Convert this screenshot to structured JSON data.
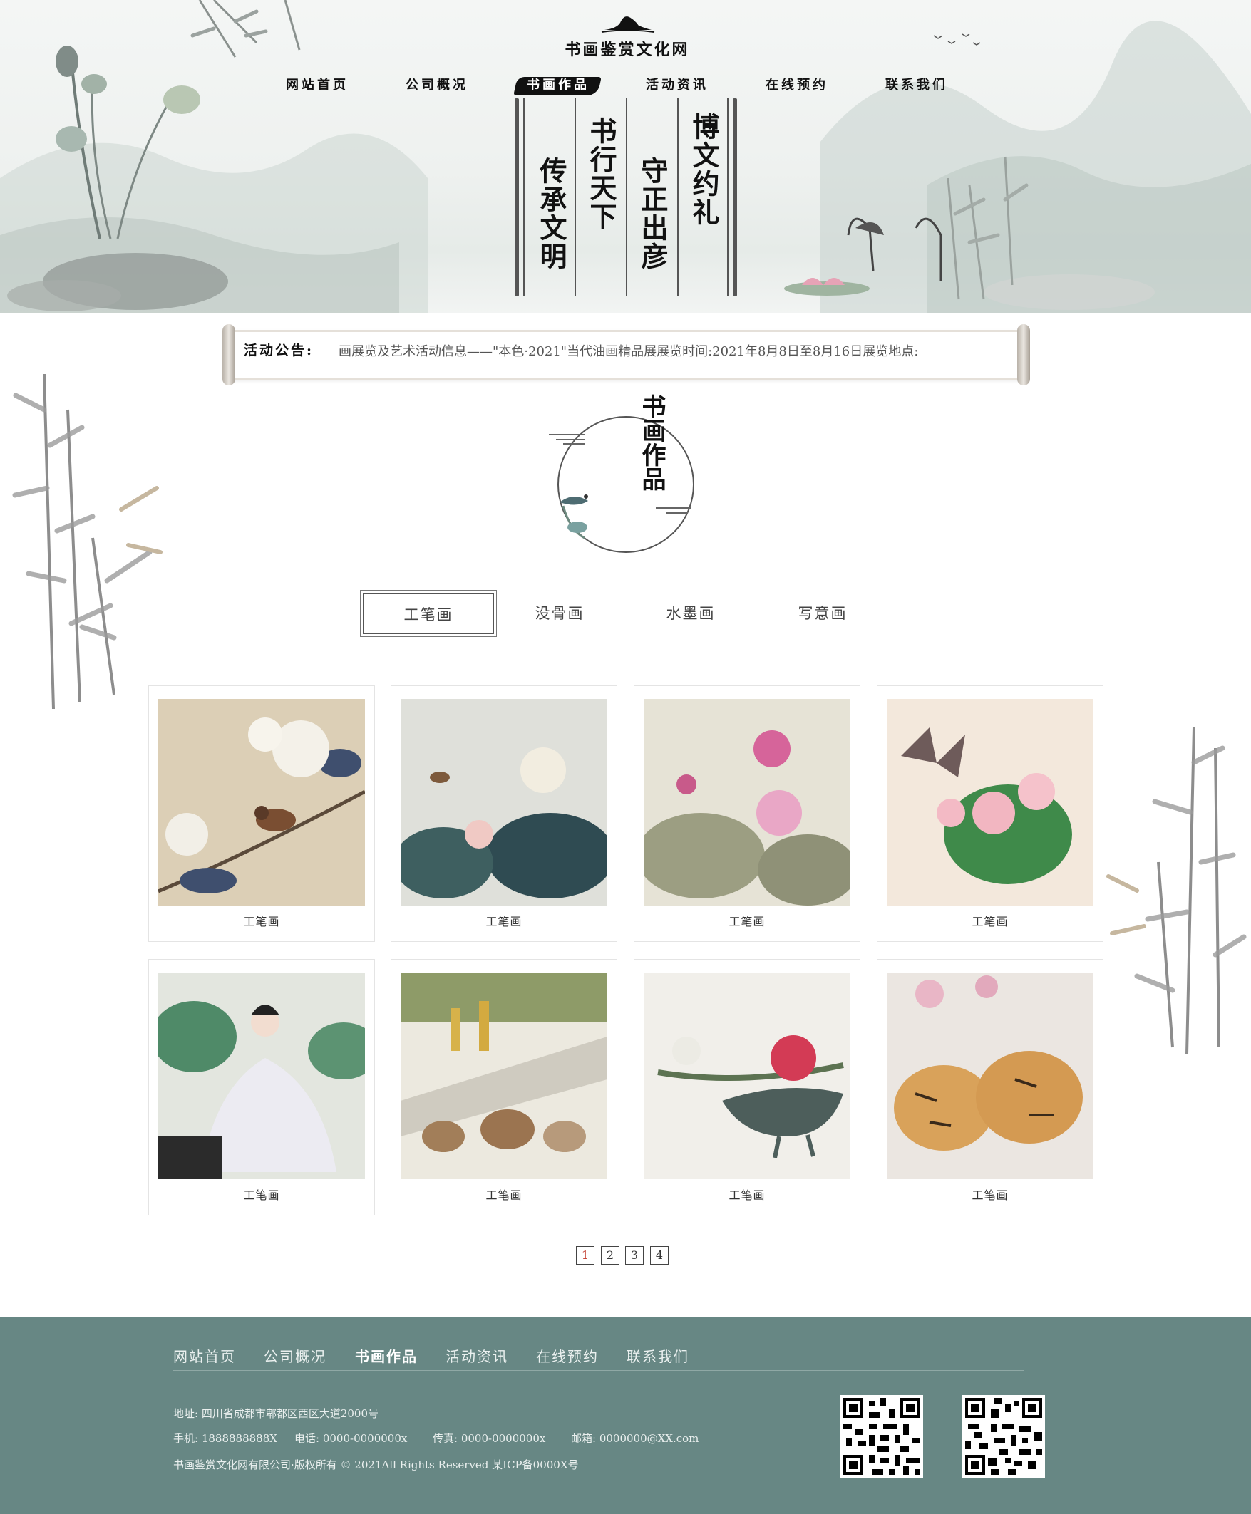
{
  "site": {
    "logo_text": "书画鉴赏文化网"
  },
  "nav": {
    "items": [
      {
        "label": "网站首页"
      },
      {
        "label": "公司概况"
      },
      {
        "label": "书画作品"
      },
      {
        "label": "活动资讯"
      },
      {
        "label": "在线预约"
      },
      {
        "label": "联系我们"
      }
    ],
    "active_index": 2
  },
  "hero_scroll": {
    "columns": [
      "博文约礼",
      "守正出彦",
      "书行天下",
      "传承文明"
    ]
  },
  "notice": {
    "label": "活动公告:",
    "text": "画展览及艺术活动信息——\"本色·2021\"当代油画精品展展览时间:2021年8月8日至8月16日展览地点:"
  },
  "section": {
    "title": "书画作品"
  },
  "tabs": [
    {
      "label": "工笔画",
      "active": true
    },
    {
      "label": "没骨画",
      "active": false
    },
    {
      "label": "水墨画",
      "active": false
    },
    {
      "label": "写意画",
      "active": false
    }
  ],
  "gallery": [
    {
      "caption": "工笔画",
      "subject": "bird-hydrangea"
    },
    {
      "caption": "工笔画",
      "subject": "lotus-leaves-bird"
    },
    {
      "caption": "工笔画",
      "subject": "pink-lotus"
    },
    {
      "caption": "工笔画",
      "subject": "butterfly-peony"
    },
    {
      "caption": "工笔画",
      "subject": "lady-lotus"
    },
    {
      "caption": "工笔画",
      "subject": "rabbits-corn"
    },
    {
      "caption": "工笔画",
      "subject": "peony-vase"
    },
    {
      "caption": "工笔画",
      "subject": "tigers"
    }
  ],
  "pagination": {
    "pages": [
      "1",
      "2",
      "3",
      "4"
    ],
    "current": "1"
  },
  "footer": {
    "nav": [
      {
        "label": "网站首页"
      },
      {
        "label": "公司概况"
      },
      {
        "label": "书画作品"
      },
      {
        "label": "活动资讯"
      },
      {
        "label": "在线预约"
      },
      {
        "label": "联系我们"
      }
    ],
    "address": "地址: 四川省成都市郫都区西区大道2000号",
    "phone": "手机: 1888888888X",
    "tel": "电话: 0000-0000000x",
    "fax": "传真: 0000-0000000x",
    "email": "邮箱: 0000000@XX.com",
    "copyright": "书画鉴赏文化网有限公司·版权所有 © 2021All Rights Reserved 某ICP备0000X号"
  },
  "colors": {
    "footer_bg": "#678784",
    "page_active": "#c0392b",
    "ink": "#111111"
  }
}
